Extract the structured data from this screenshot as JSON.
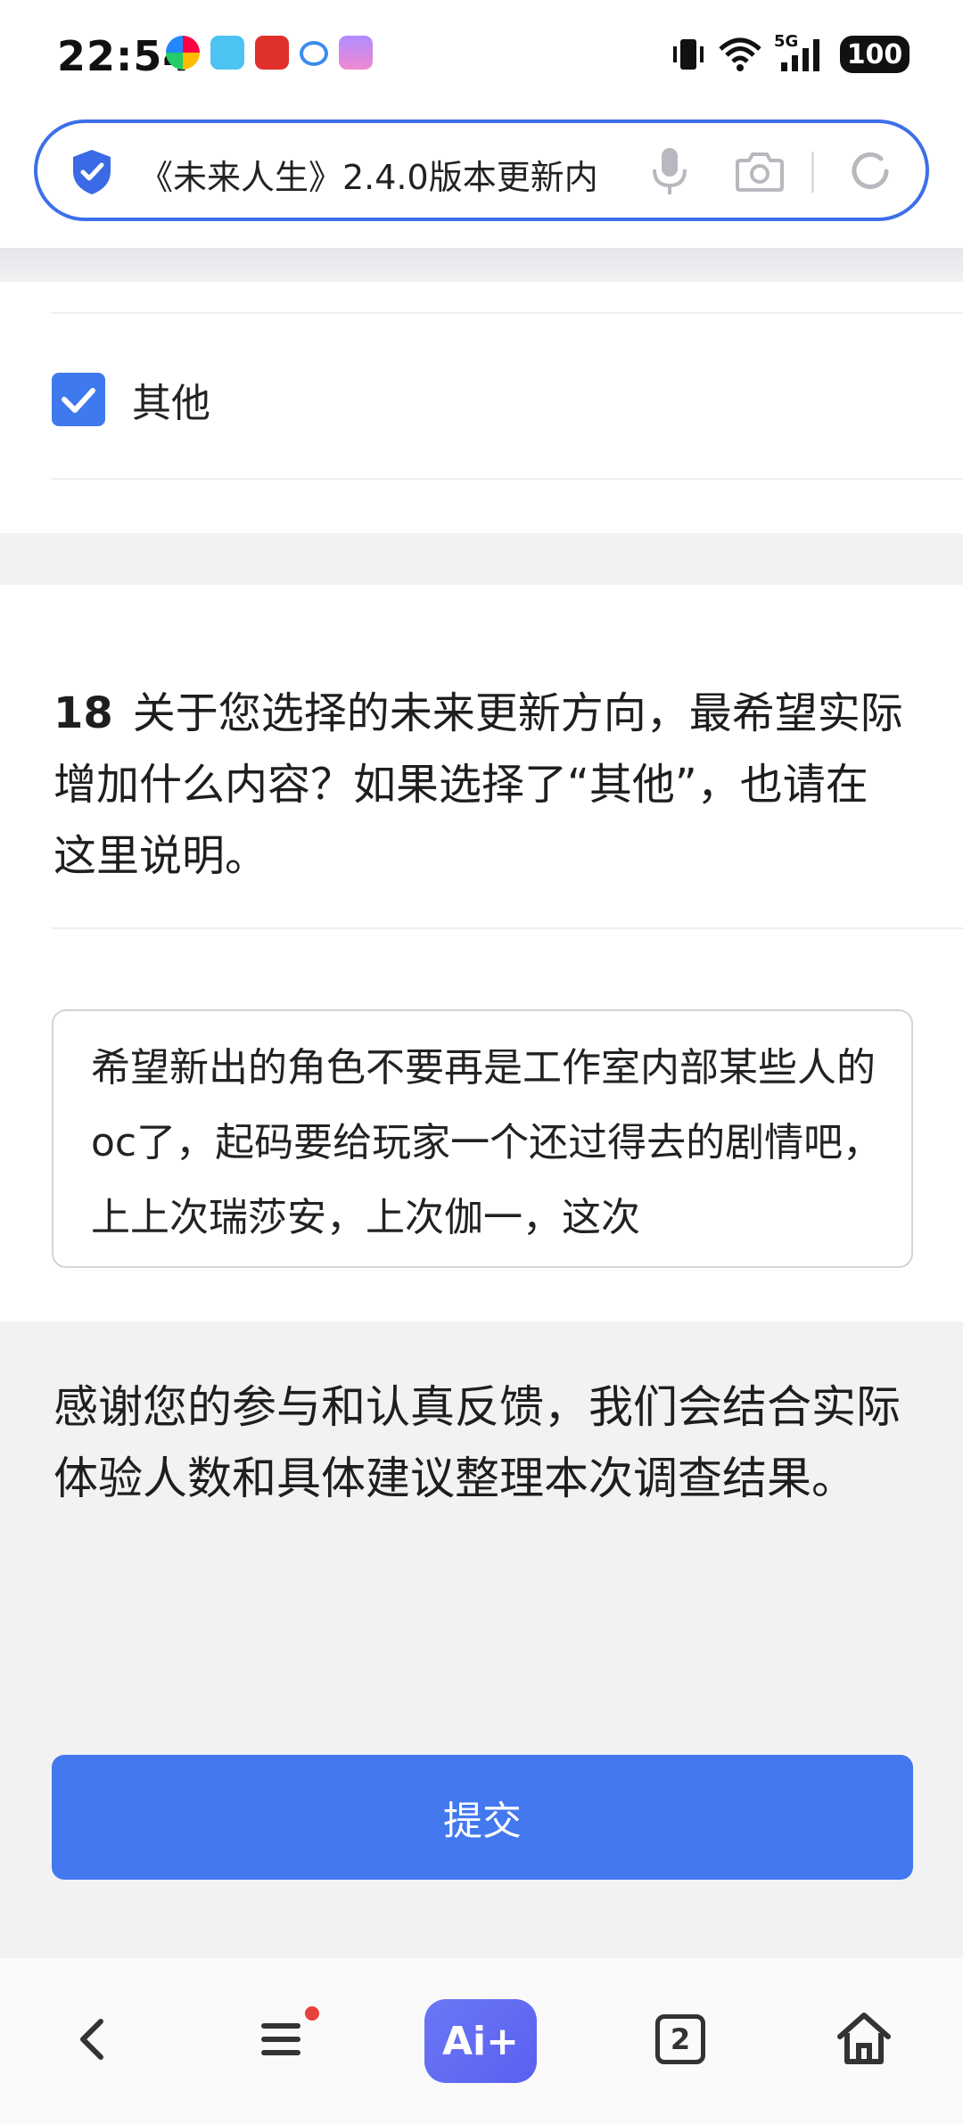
{
  "status_bar": {
    "time": "22:54",
    "network": "5G",
    "battery": "100"
  },
  "address_bar": {
    "text": "《未来人生》2.4.0版本更新内"
  },
  "options": {
    "other_label": "其他",
    "other_checked": true
  },
  "question": {
    "number": "18",
    "text": "关于您选择的未来更新方向，最希望实际增加什么内容？如果选择了“其他”，也请在这里说明。"
  },
  "answer": {
    "value": "希望新出的角色不要再是工作室内部某些人的oc了，起码要给玩家一个还过得去的剧情吧，上上次瑞莎安，上次伽一，这次"
  },
  "thanks_text": "感谢您的参与和认真反馈，我们会结合实际体验人数和具体建议整理本次调查结果。",
  "submit_label": "提交",
  "bottom_nav": {
    "ai_label": "Ai+",
    "tab_count": "2"
  },
  "colors": {
    "accent": "#4378ee",
    "address_border": "#3c6fe8",
    "page_bg": "#f2f2f4"
  }
}
